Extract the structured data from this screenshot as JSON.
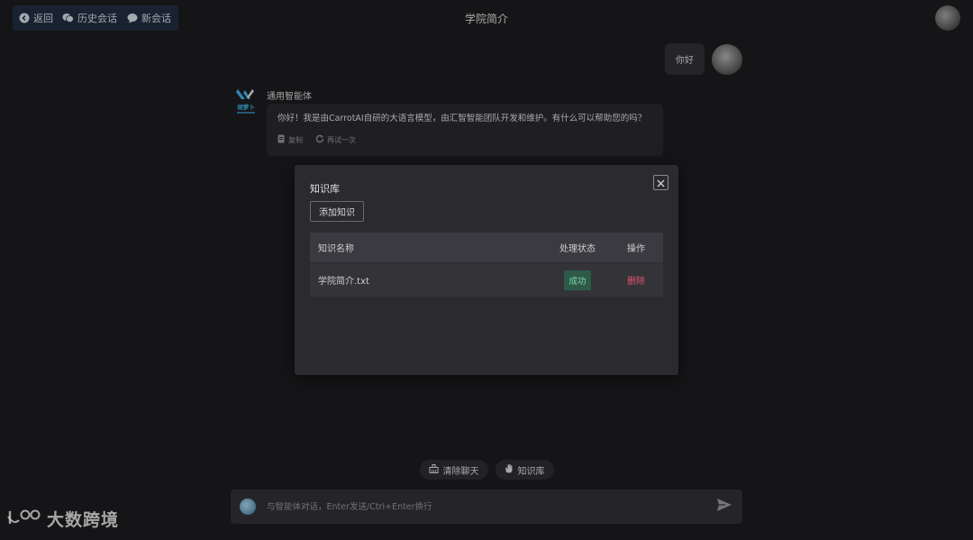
{
  "nav": {
    "back_label": "返回",
    "history_label": "历史会话",
    "new_label": "新会话"
  },
  "page_title": "学院简介",
  "user_message": "你好",
  "bot": {
    "logo_text": "胡萝卜",
    "name": "通用智能体",
    "message": "你好！我是由CarrotAI自研的大语言模型，由汇智智能团队开发和维护。有什么可以帮助您的吗？",
    "copy_label": "复制",
    "retry_label": "再试一次"
  },
  "modal": {
    "title": "知识库",
    "add_button": "添加知识",
    "columns": [
      "知识名称",
      "处理状态",
      "操作"
    ],
    "rows": [
      {
        "name": "学院简介.txt",
        "status": "成功",
        "action": "删除"
      }
    ]
  },
  "quick_actions": {
    "clear_label": "清除聊天",
    "kb_label": "知识库"
  },
  "input": {
    "placeholder": "与智能体对话，Enter发送/Ctrl+Enter换行"
  },
  "watermark": {
    "text": "大数跨境"
  },
  "colors": {
    "background": "#1a1a1d",
    "success": "#7fd3a7",
    "danger": "#e4576a"
  }
}
